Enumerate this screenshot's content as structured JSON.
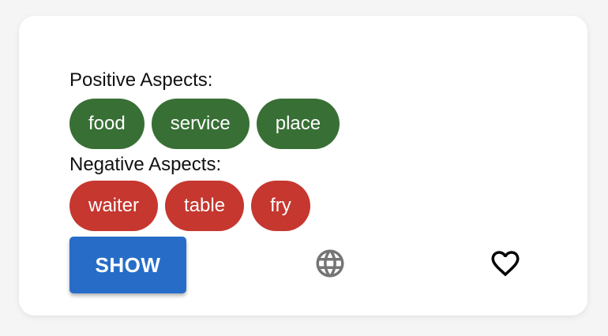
{
  "positive": {
    "label": "Positive Aspects:",
    "chips": [
      "food",
      "service",
      "place"
    ]
  },
  "negative": {
    "label": "Negative Aspects:",
    "chips": [
      "waiter",
      "table",
      "fry"
    ]
  },
  "actions": {
    "show_label": "SHOW",
    "globe_icon": "globe-icon",
    "heart_icon": "heart-outline-icon"
  },
  "colors": {
    "positive": "#386f35",
    "negative": "#c5372f",
    "button": "#276dc8"
  }
}
